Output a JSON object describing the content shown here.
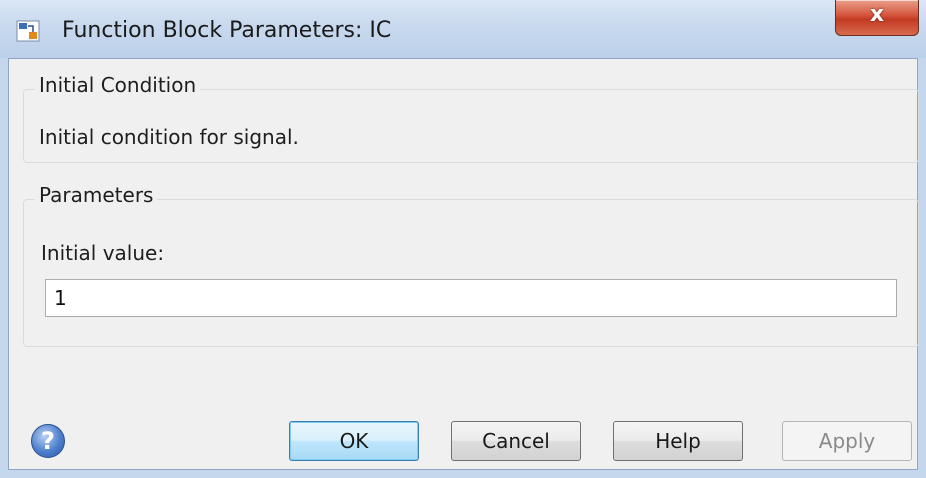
{
  "window": {
    "title": "Function Block Parameters: IC",
    "close_glyph": "x",
    "app_icon": "simulink-block-icon"
  },
  "group_initial_condition": {
    "legend": "Initial Condition",
    "description": "Initial condition for signal."
  },
  "group_parameters": {
    "legend": "Parameters",
    "initial_value_label": "Initial value:",
    "initial_value": "1"
  },
  "footer": {
    "help_icon_glyph": "?",
    "buttons": {
      "ok": "OK",
      "cancel": "Cancel",
      "help": "Help",
      "apply": "Apply"
    }
  },
  "colors": {
    "titlebar": "#c8d9ee",
    "close_button": "#c23a22",
    "dialog_background": "#f0f0f0",
    "default_button_border": "#3c7fb1"
  }
}
